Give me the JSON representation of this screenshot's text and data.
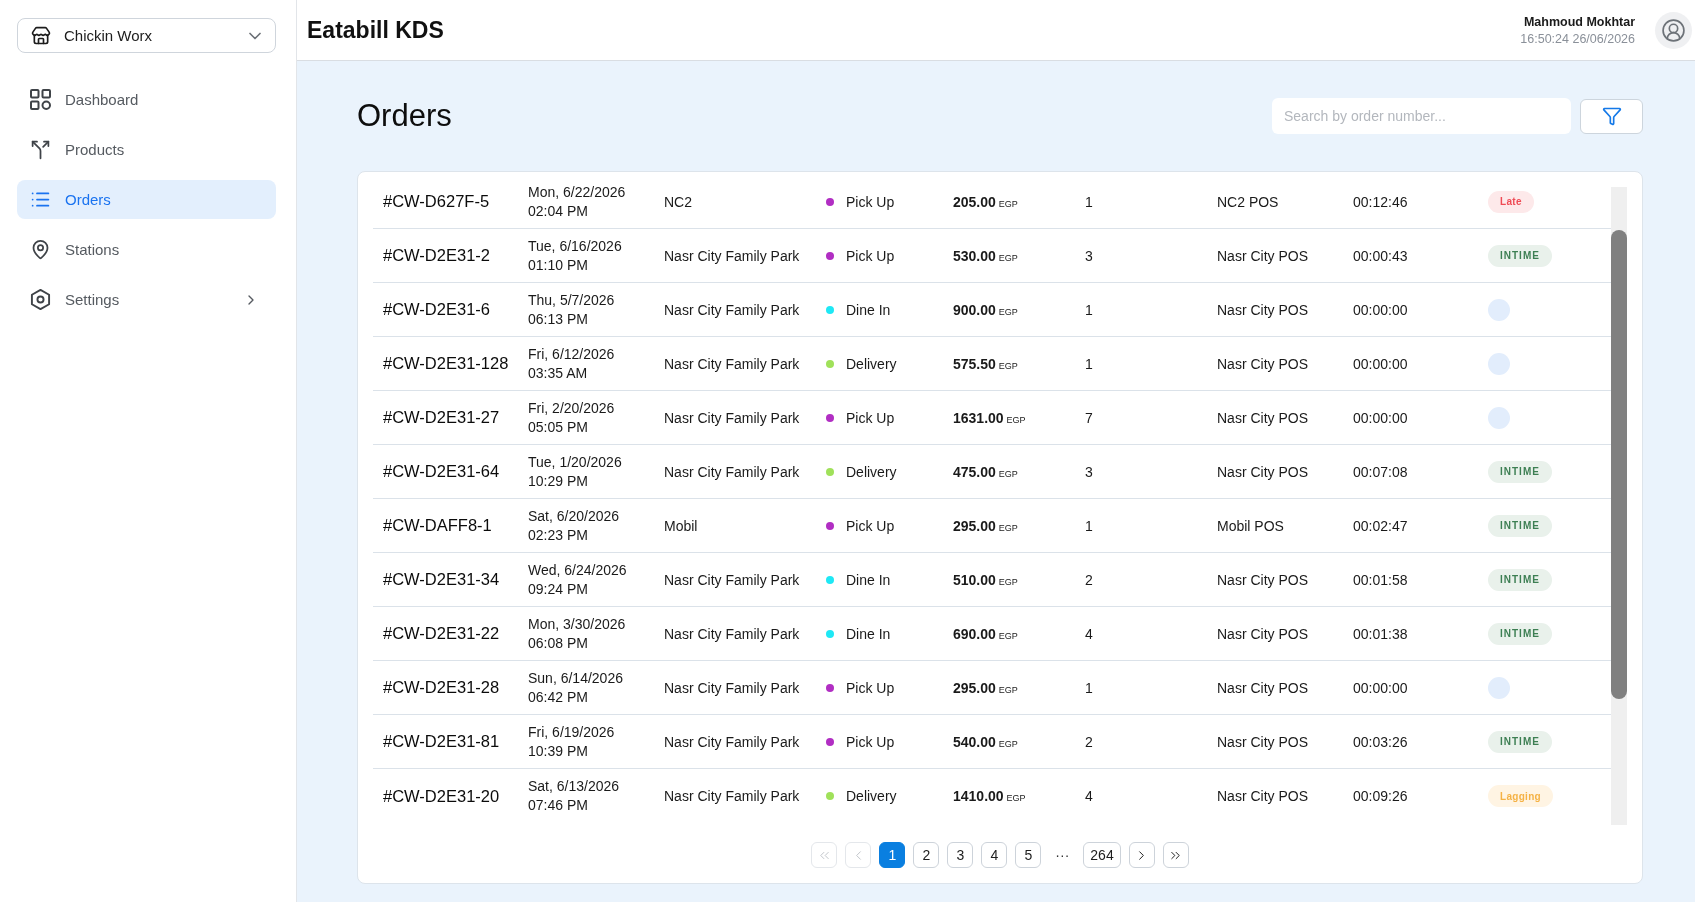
{
  "sidebar": {
    "store_selector": {
      "label": "Chickin Worx"
    },
    "items": [
      {
        "label": "Dashboard",
        "kind": "link",
        "selected": false
      },
      {
        "label": "Products",
        "kind": "link",
        "selected": false
      },
      {
        "label": "Orders",
        "kind": "link",
        "selected": true
      },
      {
        "label": "Stations",
        "kind": "link",
        "selected": false
      },
      {
        "label": "Settings",
        "kind": "group",
        "selected": false
      }
    ]
  },
  "header": {
    "title": "Eatabill KDS",
    "user": {
      "name": "Mahmoud Mokhtar",
      "timestamp": "16:50:24 26/06/2026"
    }
  },
  "page": {
    "title": "Orders",
    "search": {
      "placeholder": "Search by order number..."
    }
  },
  "orders": {
    "rows": [
      {
        "order_number": "#CW-D627F-5",
        "date": "Mon, 6/22/2026",
        "time": "02:04 PM",
        "branch": "NC2",
        "order_type": "Pick Up",
        "color": "#b12ec3",
        "amount": "205.00",
        "currency": "EGP",
        "column_7": "1",
        "pos": "NC2 POS",
        "duration": "00:12:46",
        "status": {
          "kind": "late",
          "label": "Late"
        }
      },
      {
        "order_number": "#CW-D2E31-2",
        "date": "Tue, 6/16/2026",
        "time": "01:10 PM",
        "branch": "Nasr City Family Park",
        "order_type": "Pick Up",
        "color": "#b12ec3",
        "amount": "530.00",
        "currency": "EGP",
        "column_7": "3",
        "pos": "Nasr City POS",
        "duration": "00:00:43",
        "status": {
          "kind": "intime",
          "label": "INTIME"
        }
      },
      {
        "order_number": "#CW-D2E31-6",
        "date": "Thu, 5/7/2026",
        "time": "06:13 PM",
        "branch": "Nasr City Family Park",
        "order_type": "Dine In",
        "color": "#1ee8f5",
        "amount": "900.00",
        "currency": "EGP",
        "column_7": "1",
        "pos": "Nasr City POS",
        "duration": "00:00:00",
        "status": {
          "kind": "empty"
        }
      },
      {
        "order_number": "#CW-D2E31-128",
        "date": "Fri, 6/12/2026",
        "time": "03:35 AM",
        "branch": "Nasr City Family Park",
        "order_type": "Delivery",
        "color": "#a0e15a",
        "amount": "575.50",
        "currency": "EGP",
        "column_7": "1",
        "pos": "Nasr City POS",
        "duration": "00:00:00",
        "status": {
          "kind": "empty"
        }
      },
      {
        "order_number": "#CW-D2E31-27",
        "date": "Fri, 2/20/2026",
        "time": "05:05 PM",
        "branch": "Nasr City Family Park",
        "order_type": "Pick Up",
        "color": "#b12ec3",
        "amount": "1631.00",
        "currency": "EGP",
        "column_7": "7",
        "pos": "Nasr City POS",
        "duration": "00:00:00",
        "status": {
          "kind": "empty"
        }
      },
      {
        "order_number": "#CW-D2E31-64",
        "date": "Tue, 1/20/2026",
        "time": "10:29 PM",
        "branch": "Nasr City Family Park",
        "order_type": "Delivery",
        "color": "#a0e15a",
        "amount": "475.00",
        "currency": "EGP",
        "column_7": "3",
        "pos": "Nasr City POS",
        "duration": "00:07:08",
        "status": {
          "kind": "intime",
          "label": "INTIME"
        }
      },
      {
        "order_number": "#CW-DAFF8-1",
        "date": "Sat, 6/20/2026",
        "time": "02:23 PM",
        "branch": "Mobil",
        "order_type": "Pick Up",
        "color": "#b12ec3",
        "amount": "295.00",
        "currency": "EGP",
        "column_7": "1",
        "pos": "Mobil POS",
        "duration": "00:02:47",
        "status": {
          "kind": "intime",
          "label": "INTIME"
        }
      },
      {
        "order_number": "#CW-D2E31-34",
        "date": "Wed, 6/24/2026",
        "time": "09:24 PM",
        "branch": "Nasr City Family Park",
        "order_type": "Dine In",
        "color": "#1ee8f5",
        "amount": "510.00",
        "currency": "EGP",
        "column_7": "2",
        "pos": "Nasr City POS",
        "duration": "00:01:58",
        "status": {
          "kind": "intime",
          "label": "INTIME"
        }
      },
      {
        "order_number": "#CW-D2E31-22",
        "date": "Mon, 3/30/2026",
        "time": "06:08 PM",
        "branch": "Nasr City Family Park",
        "order_type": "Dine In",
        "color": "#1ee8f5",
        "amount": "690.00",
        "currency": "EGP",
        "column_7": "4",
        "pos": "Nasr City POS",
        "duration": "00:01:38",
        "status": {
          "kind": "intime",
          "label": "INTIME"
        }
      },
      {
        "order_number": "#CW-D2E31-28",
        "date": "Sun, 6/14/2026",
        "time": "06:42 PM",
        "branch": "Nasr City Family Park",
        "order_type": "Pick Up",
        "color": "#b12ec3",
        "amount": "295.00",
        "currency": "EGP",
        "column_7": "1",
        "pos": "Nasr City POS",
        "duration": "00:00:00",
        "status": {
          "kind": "empty"
        }
      },
      {
        "order_number": "#CW-D2E31-81",
        "date": "Fri, 6/19/2026",
        "time": "10:39 PM",
        "branch": "Nasr City Family Park",
        "order_type": "Pick Up",
        "color": "#b12ec3",
        "amount": "540.00",
        "currency": "EGP",
        "column_7": "2",
        "pos": "Nasr City POS",
        "duration": "00:03:26",
        "status": {
          "kind": "intime",
          "label": "INTIME"
        }
      },
      {
        "order_number": "#CW-D2E31-20",
        "date": "Sat, 6/13/2026",
        "time": "07:46 PM",
        "branch": "Nasr City Family Park",
        "order_type": "Delivery",
        "color": "#a0e15a",
        "amount": "1410.00",
        "currency": "EGP",
        "column_7": "4",
        "pos": "Nasr City POS",
        "duration": "00:09:26",
        "status": {
          "kind": "lagging",
          "label": "Lagging"
        }
      }
    ]
  },
  "pagination": {
    "first": {
      "disabled": true
    },
    "previous": {
      "disabled": true
    },
    "pages": [
      {
        "kind": "page",
        "label": "1",
        "selected": true
      },
      {
        "kind": "page",
        "label": "2",
        "selected": false
      },
      {
        "kind": "page",
        "label": "3",
        "selected": false
      },
      {
        "kind": "page",
        "label": "4",
        "selected": false
      },
      {
        "kind": "page",
        "label": "5",
        "selected": false
      },
      {
        "kind": "gap",
        "label": "···",
        "selected": false
      },
      {
        "kind": "page",
        "label": "264",
        "selected": false
      }
    ],
    "next": {
      "disabled": false
    },
    "last": {
      "disabled": false
    }
  }
}
